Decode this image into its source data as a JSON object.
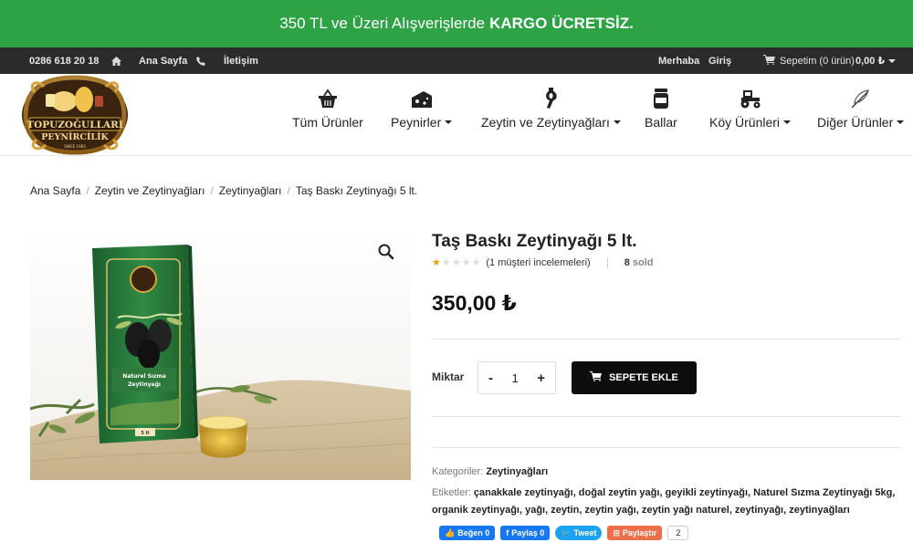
{
  "promo": {
    "text": "350 TL ve Üzeri Alışverişlerde",
    "highlight": "KARGO ÜCRETSİZ."
  },
  "topbar": {
    "phone": "0286 618 20 18",
    "home_label": "Ana Sayfa",
    "contact_label": "İletişim",
    "greeting": "Merhaba",
    "login_label": "Giriş",
    "cart_label": "Sepetim (0 ürün)",
    "cart_total": "0,00 ₺"
  },
  "logo": {
    "line1": "TOPUZOĞULLARI",
    "line2": "PEYNİRCİLİK",
    "since": "SINCE 1983"
  },
  "nav": [
    {
      "label": "Tüm Ürünler",
      "icon": "basket-icon"
    },
    {
      "label": "Peynirler",
      "icon": "cheese-icon"
    },
    {
      "label": "Zeytin ve Zeytinyağları",
      "icon": "olive-oil-icon"
    },
    {
      "label": "Ballar",
      "icon": "honey-jar-icon"
    },
    {
      "label": "Köy Ürünleri",
      "icon": "tractor-icon"
    },
    {
      "label": "Diğer Ürünler",
      "icon": "feather-icon"
    }
  ],
  "breadcrumb": [
    "Ana Sayfa",
    "Zeytin ve Zeytinyağları",
    "Zeytinyağları",
    "Taş Baskı Zeytinyağı 5 lt."
  ],
  "product": {
    "title": "Taş Baskı Zeytinyağı 5 lt.",
    "rating": 1,
    "reviews_label": "(1 müşteri incelemeleri)",
    "sold_count": "8",
    "sold_label": "sold",
    "price": "350,00 ₺",
    "qty_label": "Miktar",
    "qty_value": "1",
    "add_to_cart": "SEPETE EKLE",
    "can_brand": "Naturel Sızma",
    "can_brand2": "Zeytinyağı",
    "can_size": "5 lt"
  },
  "meta": {
    "categories_key": "Kategoriler:",
    "categories_value": "Zeytinyağları",
    "tags_key": "Etiketler:",
    "tags_line1": "çanakkale zeytinyağı, doğal zeytin yağı, geyikli zeytinyağı, Naturel Sızma Zeytinyağı 5kg,",
    "tags_line2": "organik zeytinyağı, yağı, zeytin, zeytin yağı, zeytin yağı naturel, zeytinyağı, zeytinyağları"
  },
  "share": {
    "fb_like": "Beğen 0",
    "fb_share": "Paylaş 0",
    "tweet": "Tweet",
    "share": "Paylaştır",
    "count": "2"
  },
  "colors": {
    "promo_bg": "#2ea345",
    "topbar_bg": "#2b2b2b",
    "cart_btn": "#0d0d0d",
    "star": "#f2a100"
  }
}
